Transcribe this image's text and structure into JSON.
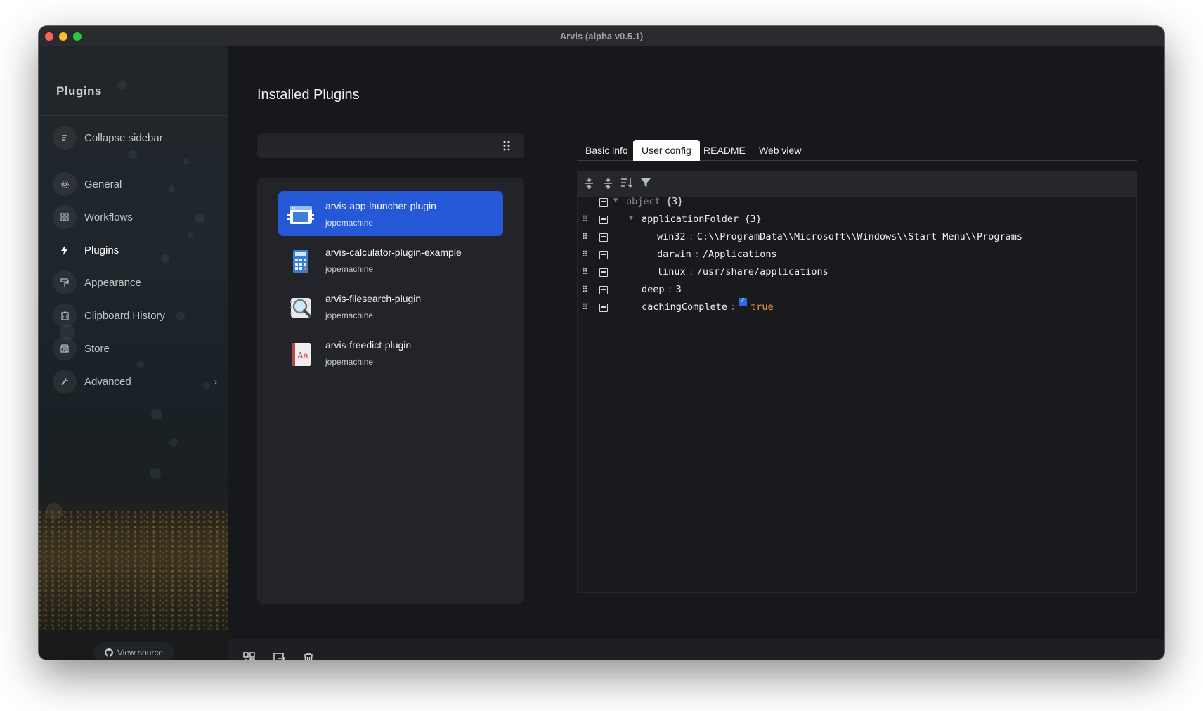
{
  "window": {
    "title": "Arvis (alpha v0.5.1)"
  },
  "sidebar": {
    "title": "Plugins",
    "items": [
      {
        "label": "Collapse sidebar",
        "icon": "collapse-icon"
      },
      {
        "label": "General",
        "icon": "gear-icon"
      },
      {
        "label": "Workflows",
        "icon": "workflow-icon"
      },
      {
        "label": "Plugins",
        "icon": "lightning-icon"
      },
      {
        "label": "Appearance",
        "icon": "paint-roller-icon"
      },
      {
        "label": "Clipboard History",
        "icon": "clipboard-icon"
      },
      {
        "label": "Store",
        "icon": "store-icon"
      },
      {
        "label": "Advanced",
        "icon": "wrench-icon"
      }
    ],
    "active": "Plugins",
    "view_source_label": "View source"
  },
  "main": {
    "title": "Installed Plugins",
    "plugins": [
      {
        "name": "arvis-app-launcher-plugin",
        "author": "jopemachine",
        "selected": true
      },
      {
        "name": "arvis-calculator-plugin-example",
        "author": "jopemachine",
        "selected": false
      },
      {
        "name": "arvis-filesearch-plugin",
        "author": "jopemachine",
        "selected": false
      },
      {
        "name": "arvis-freedict-plugin",
        "author": "jopemachine",
        "selected": false
      }
    ],
    "tabs": [
      "Basic info",
      "User config",
      "README",
      "Web view"
    ],
    "active_tab": "User config"
  },
  "json_editor": {
    "root_key": "object",
    "root_count": "{3}",
    "folder_key": "applicationFolder",
    "folder_count": "{3}",
    "entries": {
      "win32_key": "win32",
      "win32_val": "C:\\\\ProgramData\\\\Microsoft\\\\Windows\\\\Start Menu\\\\Programs",
      "darwin_key": "darwin",
      "darwin_val": "/Applications",
      "linux_key": "linux",
      "linux_val": "/usr/share/applications",
      "deep_key": "deep",
      "deep_val": "3",
      "caching_key": "cachingComplete",
      "caching_val": "true"
    },
    "colon": ":"
  },
  "colors": {
    "accent": "#2458d6",
    "boolean": "#f59a3c"
  }
}
